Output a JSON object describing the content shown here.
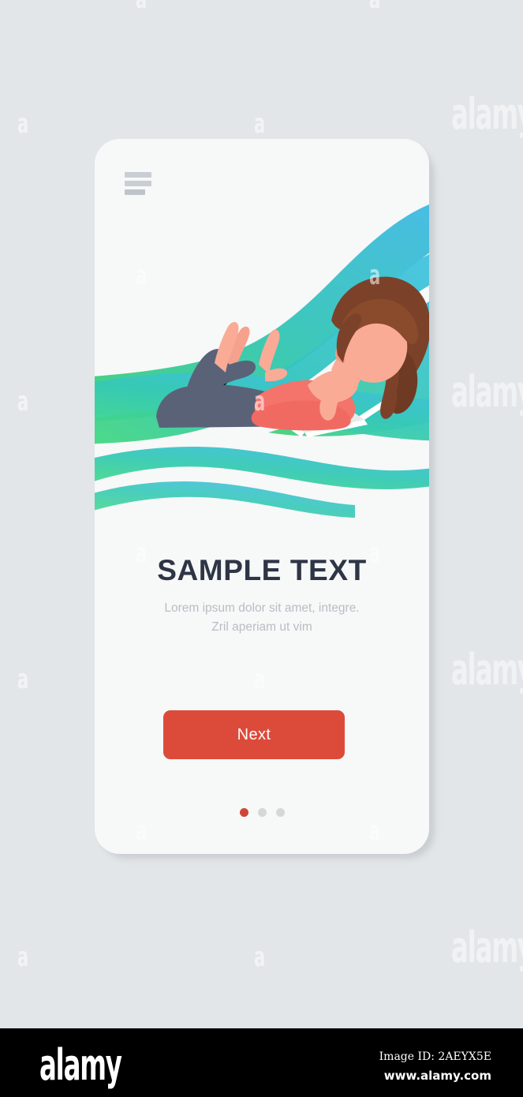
{
  "background": {
    "color": "#e3e6e9",
    "watermark_text": "a",
    "watermark_word": "alamy"
  },
  "phone": {
    "frame_color": "#f7f8f8",
    "menu": {
      "icon": "hamburger-menu-icon",
      "bars": 3
    },
    "illustration": {
      "name": "woman-lying-with-laptop-illustration",
      "description": "Young woman lying on her stomach with legs bent up, using a laptop, over flowing green-to-blue wave ribbons",
      "colors": {
        "green": "#3fd072",
        "teal": "#35c6b0",
        "cyan": "#3fc6dd",
        "blue": "#40b5e8",
        "skin": "#f8a592",
        "hair_dark": "#7c4229",
        "hair_light": "#a0542f",
        "top": "#f4736a",
        "leggings": "#5a6278",
        "laptop": "#ffffff"
      }
    },
    "copy": {
      "title": "SAMPLE TEXT",
      "subtitle_line_1": "Lorem ipsum dolor sit amet, integre.",
      "subtitle_line_2": "Zril aperiam ut vim",
      "title_color": "#2e3545",
      "subtitle_color": "#b9bdc3"
    },
    "cta": {
      "label": "Next",
      "color": "#dc4b3a",
      "text_color": "#fdfdfd"
    },
    "pager": {
      "total": 3,
      "active_index": 0,
      "active_color": "#cf4436",
      "inactive_color": "#d6d7d9"
    }
  },
  "footer": {
    "logo": "alamy",
    "image_id": "Image ID: 2AEYX5E",
    "url": "www.alamy.com",
    "background": "#000000"
  }
}
